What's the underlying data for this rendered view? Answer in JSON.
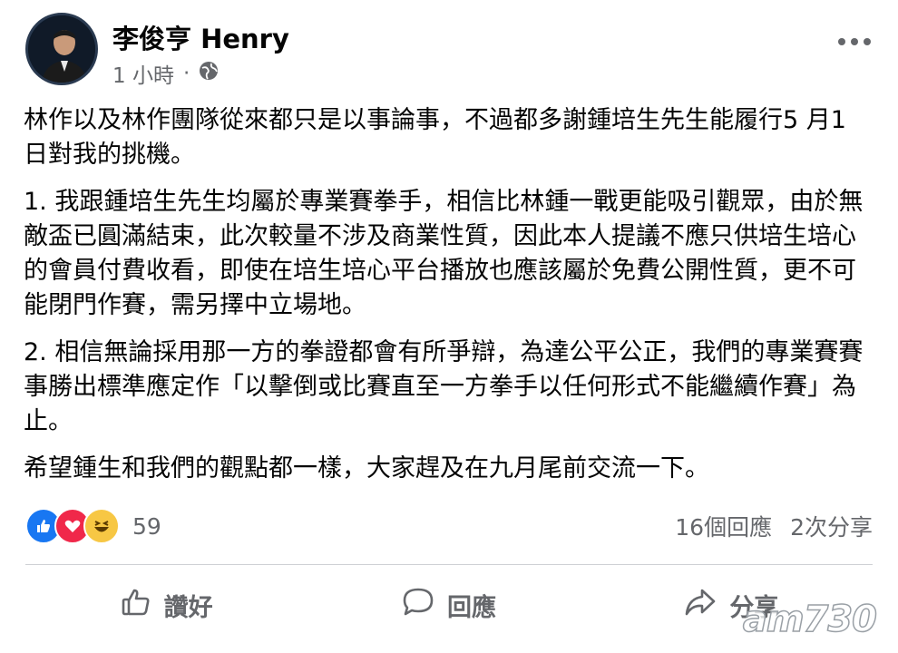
{
  "post": {
    "author": "李俊亨 Henry",
    "time": "1 小時",
    "separator": "·",
    "paragraphs": [
      "林作以及林作團隊從來都只是以事論事，不過都多謝鍾培生先生能履行5 月1 日對我的挑機。",
      "1. 我跟鍾培生先生均屬於專業賽拳手，相信比林鍾一戰更能吸引觀眾，由於無敵盃已圓滿結束，此次較量不涉及商業性質，因此本人提議不應只供培生培心的會員付費收看，即使在培生培心平台播放也應該屬於免費公開性質，更不可能閉門作賽，需另擇中立場地。",
      "2. 相信無論採用那一方的拳證都會有所爭辯，為達公平公正，我們的專業賽賽事勝出標準應定作「以擊倒或比賽直至一方拳手以任何形式不能繼續作賽」為止。",
      "希望鍾生和我們的觀點都一樣，大家趕及在九月尾前交流一下。"
    ]
  },
  "stats": {
    "reaction_count": "59",
    "comments": "16個回應",
    "shares": "2次分享"
  },
  "actions": {
    "like": "讚好",
    "comment": "回應",
    "share": "分享"
  },
  "watermark": "am730",
  "icons": {
    "privacy": "globe-icon",
    "more": "more-options-icon",
    "like": "thumbs-up-icon",
    "comment": "comment-bubble-icon",
    "share": "share-arrow-icon"
  },
  "colors": {
    "like": "#1877f2",
    "love": "#f0284a",
    "haha": "#f7c744",
    "secondary_text": "#65676b"
  }
}
